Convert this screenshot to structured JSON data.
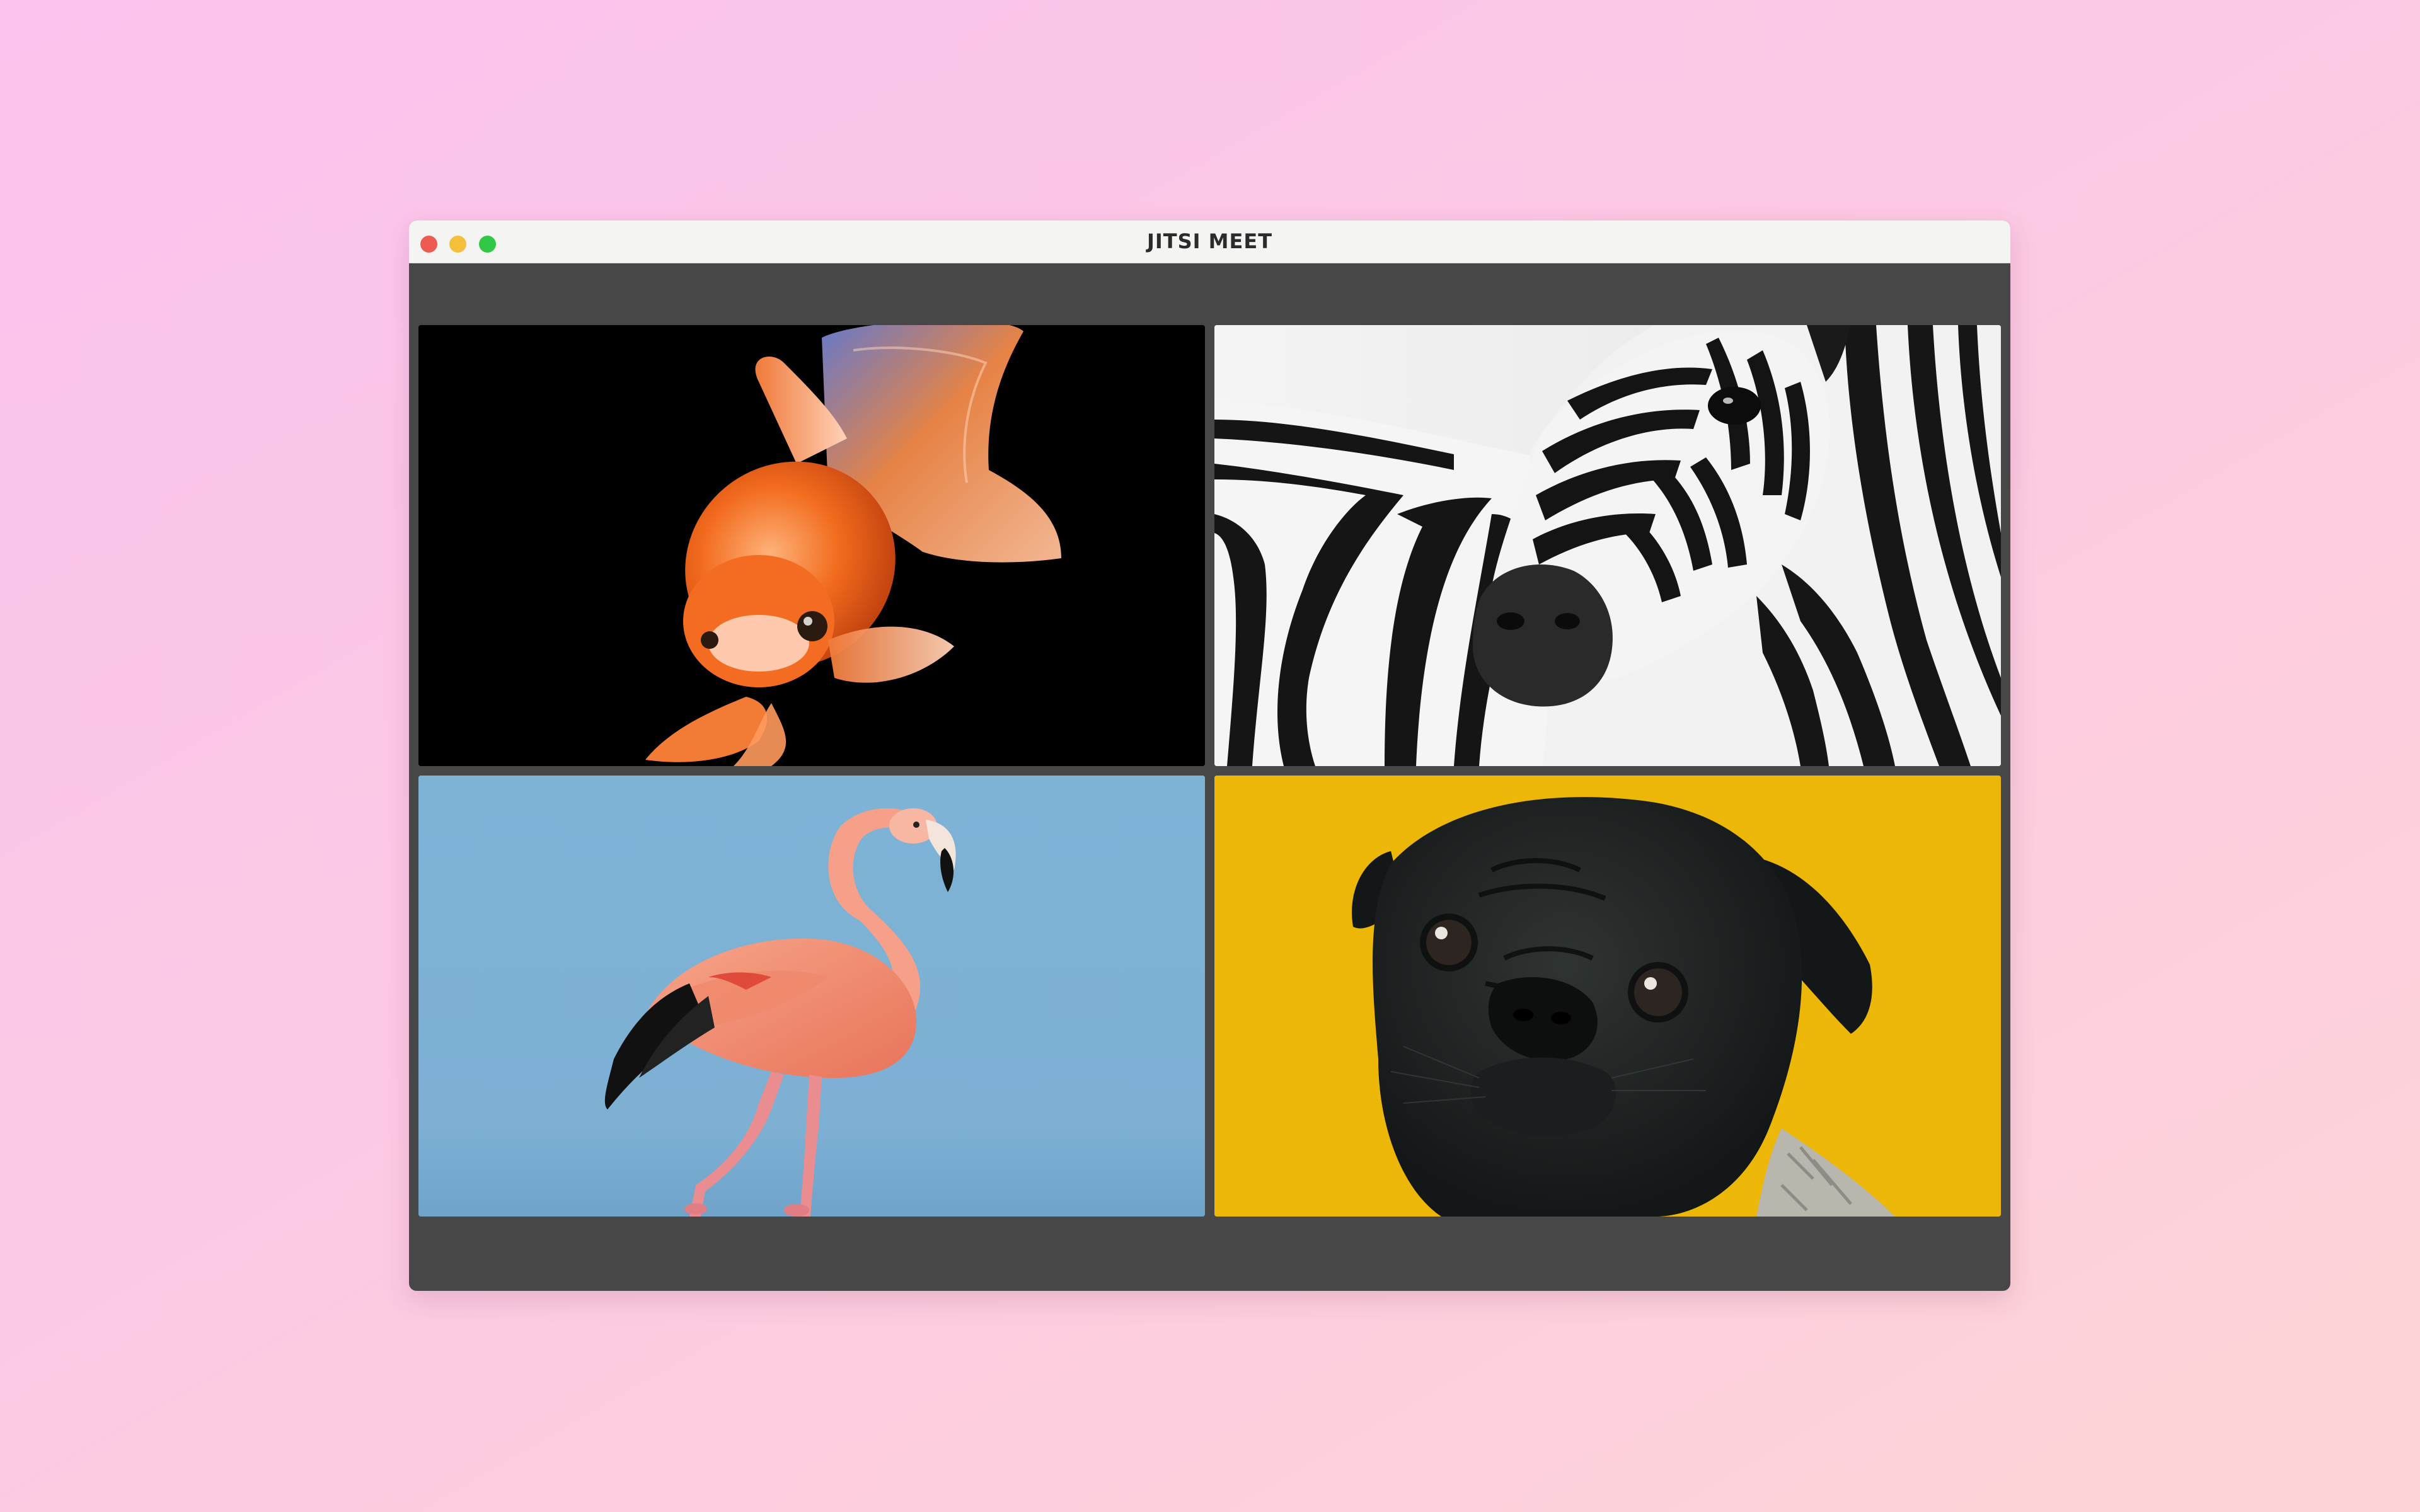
{
  "window": {
    "title": "JITSI MEET",
    "controls": {
      "close_color": "#ee5b52",
      "minimize_color": "#f4bf3a",
      "maximize_color": "#33c748"
    }
  },
  "participants": [
    {
      "subject": "goldfish",
      "background": "#000000"
    },
    {
      "subject": "zebra",
      "background": "#efefef"
    },
    {
      "subject": "flamingo",
      "background": "#7fb2d4"
    },
    {
      "subject": "pug",
      "background": "#edb707"
    }
  ],
  "colors": {
    "stage": "#474747",
    "titlebar": "#f4f4f2"
  }
}
